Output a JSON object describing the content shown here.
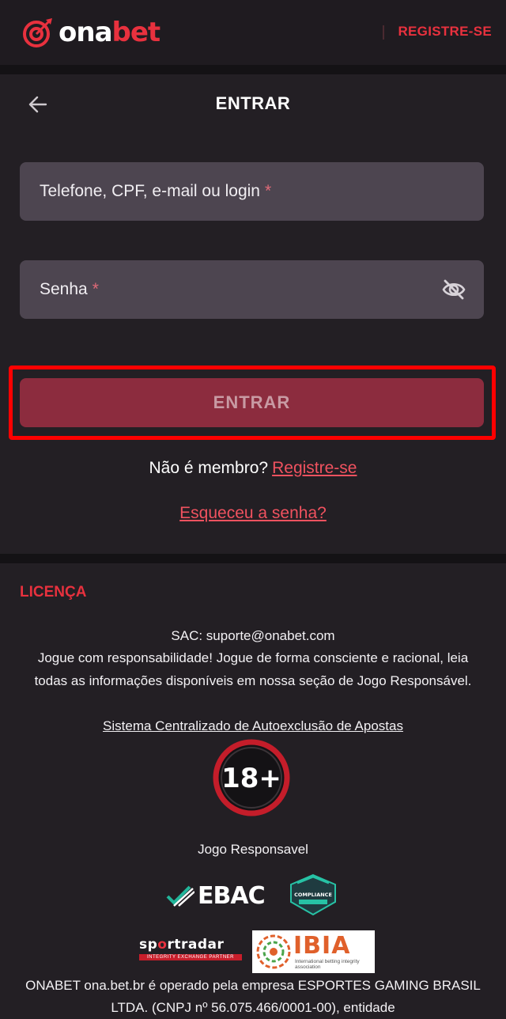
{
  "header": {
    "logo_text_prefix": "ona",
    "logo_text_suffix": "bet",
    "register_label": "REGISTRE-SE"
  },
  "login": {
    "title": "ENTRAR",
    "login_placeholder": "Telefone, CPF, e-mail ou login",
    "password_placeholder": "Senha",
    "required_mark": "*",
    "submit_label": "ENTRAR",
    "member_question": "Não é membro?",
    "member_register_link": "Registre-se",
    "forgot_password": "Esqueceu a senha?"
  },
  "footer": {
    "license_title": "LICENÇA",
    "sac": "SAC: suporte@onabet.com",
    "responsibility": "Jogue com responsabilidade! Jogue de forma consciente e racional, leia todas as informações disponíveis em nossa seção de Jogo Responsável.",
    "self_exclusion_link": "Sistema Centralizado de Autoexclusão de Apostas",
    "age_badge": "18+",
    "responsible_gaming": "Jogo Responsavel",
    "ebac_label": "EBAC",
    "compliance_label": "COMPLIANCE",
    "sportradar_prefix": "sp",
    "sportradar_o": "o",
    "sportradar_suffix": "rtradar",
    "sportradar_tagline": "INTEGRITY EXCHANGE PARTNER",
    "ibia_label": "IBIA",
    "ibia_subtitle": "International betting integrity association",
    "operator_text": "ONABET ona.bet.br é operado pela empresa ESPORTES GAMING BRASIL LTDA. (CNPJ nº 56.075.466/0001-00), entidade"
  },
  "colors": {
    "accent": "#e8313e",
    "link": "#f0525f",
    "submit_bg": "#8c2c3e",
    "field_bg": "#4d4550",
    "page_bg": "#231f24"
  }
}
